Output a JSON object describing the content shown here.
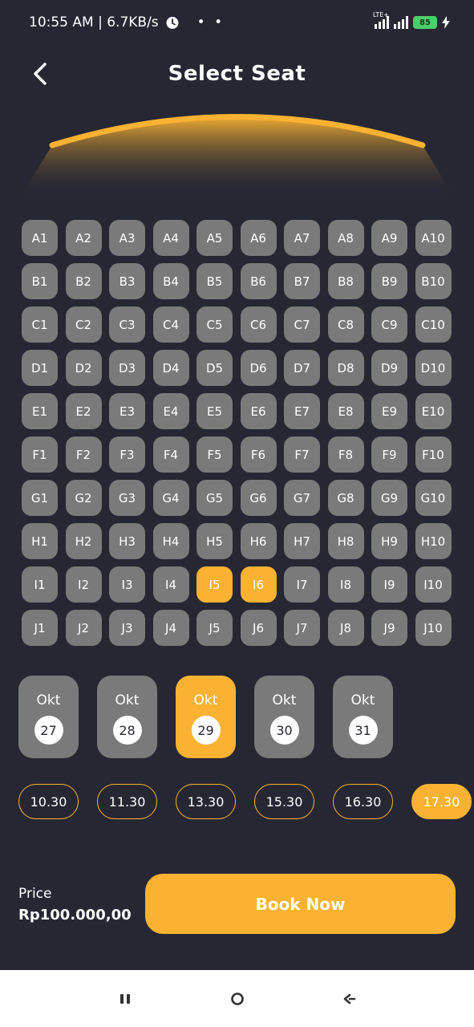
{
  "status_bar": {
    "time": "10:55 AM | 6.7KB/s",
    "dots": "• •",
    "network_label": "LTE+",
    "battery": "85"
  },
  "header": {
    "title": "Select Seat"
  },
  "colors": {
    "background": "#262733",
    "accent": "#fbb232",
    "seat_available": "#7a7a7a"
  },
  "seats": {
    "rows": [
      [
        "A1",
        "A2",
        "A3",
        "A4",
        "A5",
        "A6",
        "A7",
        "A8",
        "A9",
        "A10"
      ],
      [
        "B1",
        "B2",
        "B3",
        "B4",
        "B5",
        "B6",
        "B7",
        "B8",
        "B9",
        "B10"
      ],
      [
        "C1",
        "C2",
        "C3",
        "C4",
        "C5",
        "C6",
        "C7",
        "C8",
        "C9",
        "C10"
      ],
      [
        "D1",
        "D2",
        "D3",
        "D4",
        "D5",
        "D6",
        "D7",
        "D8",
        "D9",
        "D10"
      ],
      [
        "E1",
        "E2",
        "E3",
        "E4",
        "E5",
        "E6",
        "E7",
        "E8",
        "E9",
        "E10"
      ],
      [
        "F1",
        "F2",
        "F3",
        "F4",
        "F5",
        "F6",
        "F7",
        "F8",
        "F9",
        "F10"
      ],
      [
        "G1",
        "G2",
        "G3",
        "G4",
        "G5",
        "G6",
        "G7",
        "G8",
        "G9",
        "G10"
      ],
      [
        "H1",
        "H2",
        "H3",
        "H4",
        "H5",
        "H6",
        "H7",
        "H8",
        "H9",
        "H10"
      ],
      [
        "I1",
        "I2",
        "I3",
        "I4",
        "I5",
        "I6",
        "I7",
        "I8",
        "I9",
        "I10"
      ],
      [
        "J1",
        "J2",
        "J3",
        "J4",
        "J5",
        "J6",
        "J7",
        "J8",
        "J9",
        "J10"
      ]
    ],
    "selected": [
      "I5",
      "I6"
    ]
  },
  "dates": [
    {
      "month": "Okt",
      "day": "27",
      "selected": false
    },
    {
      "month": "Okt",
      "day": "28",
      "selected": false
    },
    {
      "month": "Okt",
      "day": "29",
      "selected": true
    },
    {
      "month": "Okt",
      "day": "30",
      "selected": false
    },
    {
      "month": "Okt",
      "day": "31",
      "selected": false
    }
  ],
  "times": [
    {
      "label": "10.30",
      "selected": false
    },
    {
      "label": "11.30",
      "selected": false
    },
    {
      "label": "13.30",
      "selected": false
    },
    {
      "label": "15.30",
      "selected": false
    },
    {
      "label": "16.30",
      "selected": false
    },
    {
      "label": "17.30",
      "selected": true
    }
  ],
  "booking": {
    "price_label": "Price",
    "price_value": "Rp100.000,00",
    "book_label": "Book Now"
  },
  "icons": {
    "back": "back-arrow-icon",
    "alarm": "alarm-clock-icon",
    "nav_recents": "recents-icon",
    "nav_home": "home-icon",
    "nav_back": "nav-back-icon"
  }
}
